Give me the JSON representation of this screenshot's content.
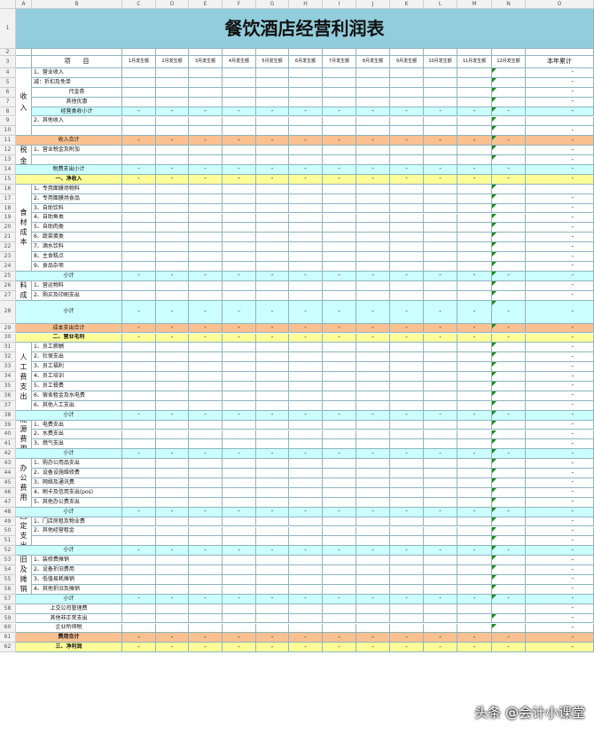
{
  "sheet": {
    "title": "餐饮酒店经营利润表",
    "columns": [
      "A",
      "B",
      "C",
      "D",
      "E",
      "F",
      "G",
      "H",
      "I",
      "J",
      "K",
      "L",
      "M",
      "N",
      "O"
    ],
    "header": {
      "item_label": "项　　目",
      "months": [
        "1月发生额",
        "2月发生额",
        "3月发生额",
        "4月发生额",
        "5月发生额",
        "6月发生额",
        "7月发生额",
        "8月发生额",
        "9月发生额",
        "10月发生额",
        "11月发生额",
        "12月发生额"
      ],
      "total_label": "本年累计"
    },
    "dash": "-",
    "colors": {
      "title_bg": "#92cddc",
      "cyan": "#ccffff",
      "orange": "#fac090",
      "yellow": "#ffff99",
      "grid": "#8fb4bf"
    },
    "categories": [
      {
        "key": "income",
        "label": "收入"
      },
      {
        "key": "tax",
        "label": "税金"
      },
      {
        "key": "material",
        "label": "食材成本"
      },
      {
        "key": "supplies",
        "label": "物料成本"
      },
      {
        "key": "labor",
        "label": "人工费支出"
      },
      {
        "key": "energy",
        "label": "能源费用"
      },
      {
        "key": "office",
        "label": "办公费用"
      },
      {
        "key": "fixed",
        "label": "固定支出"
      },
      {
        "key": "depreciation",
        "label": "折旧及摊销费"
      }
    ],
    "rows": [
      {
        "n": "1"
      },
      {
        "n": "2"
      },
      {
        "n": "3"
      },
      {
        "n": "4",
        "label": "1、营业收入"
      },
      {
        "n": "5",
        "label": "减：折扣及免单"
      },
      {
        "n": "6",
        "label": "代金券"
      },
      {
        "n": "7",
        "label": "其他优惠"
      },
      {
        "n": "8",
        "label": "经营类收小计"
      },
      {
        "n": "9",
        "label": "2、其他收入"
      },
      {
        "n": "10"
      },
      {
        "n": "11",
        "label": "收入合计"
      },
      {
        "n": "12",
        "label": "1、营业税金及附加"
      },
      {
        "n": "13"
      },
      {
        "n": "14",
        "label": "税费支出小计"
      },
      {
        "n": "15",
        "label": "一、净收入"
      },
      {
        "n": "16",
        "label": "1、专用面膜场物料"
      },
      {
        "n": "17",
        "label": "2、专用面膜场食品"
      },
      {
        "n": "18",
        "label": "3、自助饮料"
      },
      {
        "n": "19",
        "label": "4、自助鱼类"
      },
      {
        "n": "20",
        "label": "5、自助肉类"
      },
      {
        "n": "21",
        "label": "6、蔬菜蛋类"
      },
      {
        "n": "22",
        "label": "7、酒水饮料"
      },
      {
        "n": "23",
        "label": "8、主食糕点"
      },
      {
        "n": "24",
        "label": "9、食品杂项"
      },
      {
        "n": "25",
        "label": "小计"
      },
      {
        "n": "26",
        "label": "1、营运物料"
      },
      {
        "n": "27",
        "label": "2、购买及印刷支出"
      },
      {
        "n": "28",
        "label": "小计"
      },
      {
        "n": "29",
        "label": "成本支出合计"
      },
      {
        "n": "30",
        "label": "二、营业毛利"
      },
      {
        "n": "31",
        "label": "1、员工薪酬"
      },
      {
        "n": "32",
        "label": "2、社保支出"
      },
      {
        "n": "33",
        "label": "3、员工福利"
      },
      {
        "n": "34",
        "label": "4、员工培训"
      },
      {
        "n": "35",
        "label": "5、员工餐费"
      },
      {
        "n": "36",
        "label": "6、宿舍租金及水电费"
      },
      {
        "n": "37",
        "label": "6、其他人工支出"
      },
      {
        "n": "38",
        "label": "小计"
      },
      {
        "n": "39",
        "label": "1、电费支出"
      },
      {
        "n": "40",
        "label": "2、水费支出"
      },
      {
        "n": "41",
        "label": "3、燃气支出"
      },
      {
        "n": "42",
        "label": "小计"
      },
      {
        "n": "43",
        "label": "1、购办公用品支出"
      },
      {
        "n": "44",
        "label": "2、设备设施维修费"
      },
      {
        "n": "45",
        "label": "3、网络及通讯费"
      },
      {
        "n": "46",
        "label": "4、刷卡及信用支出(pos)"
      },
      {
        "n": "47",
        "label": "5、其他办公费支出"
      },
      {
        "n": "48",
        "label": "小计"
      },
      {
        "n": "49",
        "label": "1、门店房租及物业费"
      },
      {
        "n": "50",
        "label": "2、其他经营租金"
      },
      {
        "n": "51"
      },
      {
        "n": "52",
        "label": "小计"
      },
      {
        "n": "53",
        "label": "1、装修费摊销"
      },
      {
        "n": "54",
        "label": "2、设备折旧费用"
      },
      {
        "n": "55",
        "label": "3、低值易耗摊销"
      },
      {
        "n": "56",
        "label": "4、其他折旧及摊销"
      },
      {
        "n": "57",
        "label": "小计"
      },
      {
        "n": "58",
        "label": "上交公司管理费"
      },
      {
        "n": "59",
        "label": "其他非正常支出"
      },
      {
        "n": "60",
        "label": "企业所得税"
      },
      {
        "n": "61",
        "label": "费用合计"
      },
      {
        "n": "62",
        "label": "三、净利润"
      }
    ]
  },
  "watermark": "头条 @会计小课堂"
}
